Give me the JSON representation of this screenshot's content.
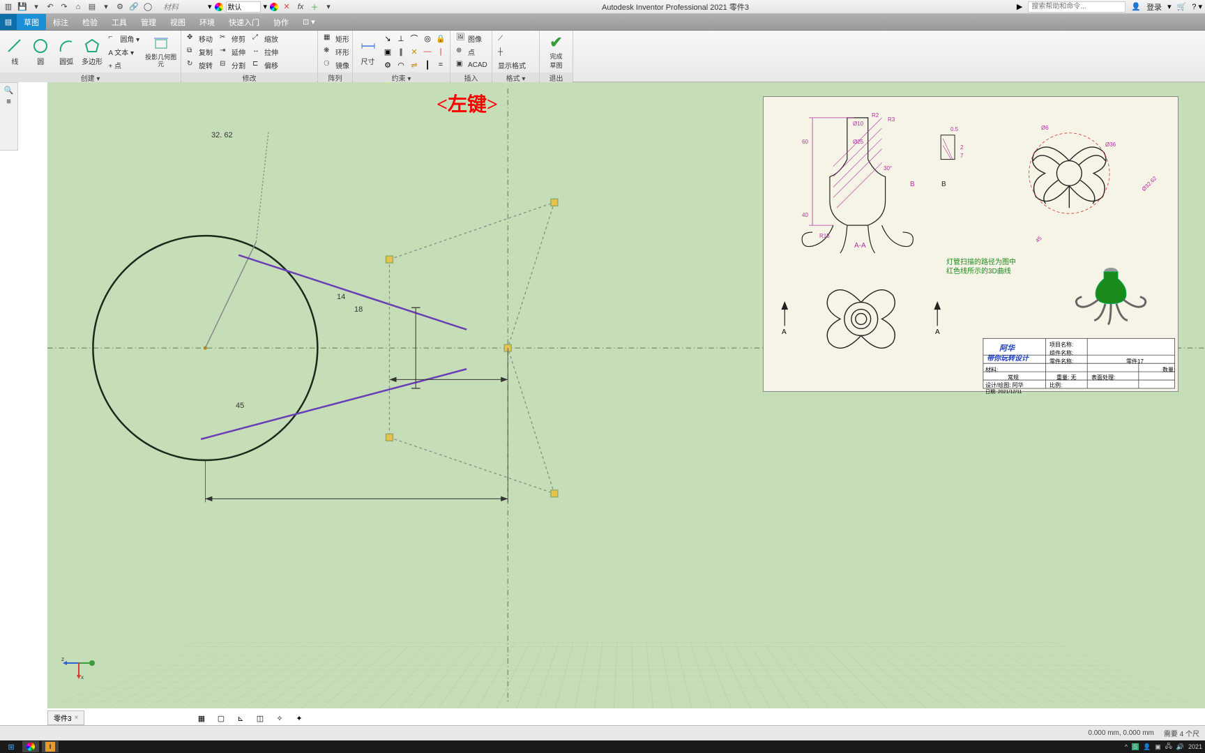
{
  "app": {
    "title": "Autodesk Inventor Professional 2021  零件3",
    "material_label": "材料",
    "appearance_default": "默认",
    "search_placeholder": "搜索帮助和命令...",
    "login": "登录"
  },
  "menu": {
    "file_icon": "▤",
    "tabs": [
      "草图",
      "标注",
      "检验",
      "工具",
      "管理",
      "视图",
      "环境",
      "快速入门",
      "协作"
    ],
    "active_index": 0
  },
  "ribbon": {
    "panels": {
      "create": {
        "label": "创建 ▾",
        "line": "线",
        "circle": "圆",
        "arc": "圆弧",
        "polygon": "多边形",
        "fillet": "圆角 ▾",
        "text": "A 文本 ▾",
        "point": "+ 点",
        "project": "投影几何图元"
      },
      "modify": {
        "label": "修改",
        "items": [
          "移动",
          "修剪",
          "缩放",
          "矩形",
          "复制",
          "延伸",
          "拉伸",
          "环形",
          "旋转",
          "分割",
          "偏移",
          "镜像"
        ]
      },
      "pattern": {
        "label": "阵列"
      },
      "constrain": {
        "label": "约束 ▾",
        "dim": "尺寸"
      },
      "insert": {
        "label": "插入",
        "image": "图像",
        "point": "点",
        "acad": "ACAD"
      },
      "format": {
        "label": "格式 ▾",
        "show": "显示格式"
      },
      "finish": {
        "label": "退出",
        "done1": "完成",
        "done2": "草图"
      }
    }
  },
  "annotation": {
    "left_click": "<左键>"
  },
  "sketch": {
    "dims": {
      "d1": "32. 62",
      "d2": "14",
      "d3": "18",
      "d4": "45"
    }
  },
  "reference": {
    "section_label": "A-A",
    "b_label1": "B",
    "b_label2": "B",
    "note1": "灯管扫描的路径为图中",
    "note2": "红色线所示的3D曲线",
    "title1": "阿华",
    "title2": "带你玩转设计",
    "tb": {
      "proj": "项目名称:",
      "comp": "组件名称:",
      "part": "零件名称:",
      "part_v": "零件17",
      "mat": "材料:",
      "view": "常规",
      "mass": "重量: 无",
      "surf": "表面处理:",
      "qty": "数量:",
      "des": "设计/绘图: 阿华",
      "scale": "比例:",
      "date": "日期: 2021/12/11"
    },
    "dims": {
      "d60": "60",
      "d40": "40",
      "r15": "R15",
      "d25": "Ø25",
      "d10": "Ø10",
      "r2": "R2",
      "r3": "R3",
      "a30": "30°",
      "d05": "0.5",
      "d2": "2",
      "d7": "7",
      "d6": "Ø6",
      "d36": "Ø36",
      "d3262": "Ø32.62",
      "d45": "45"
    }
  },
  "doc_tab": "零件3",
  "status": {
    "coords": "0.000 mm, 0.000 mm",
    "need": "需要 4 个尺"
  },
  "taskbar": {
    "clock": "2021"
  }
}
